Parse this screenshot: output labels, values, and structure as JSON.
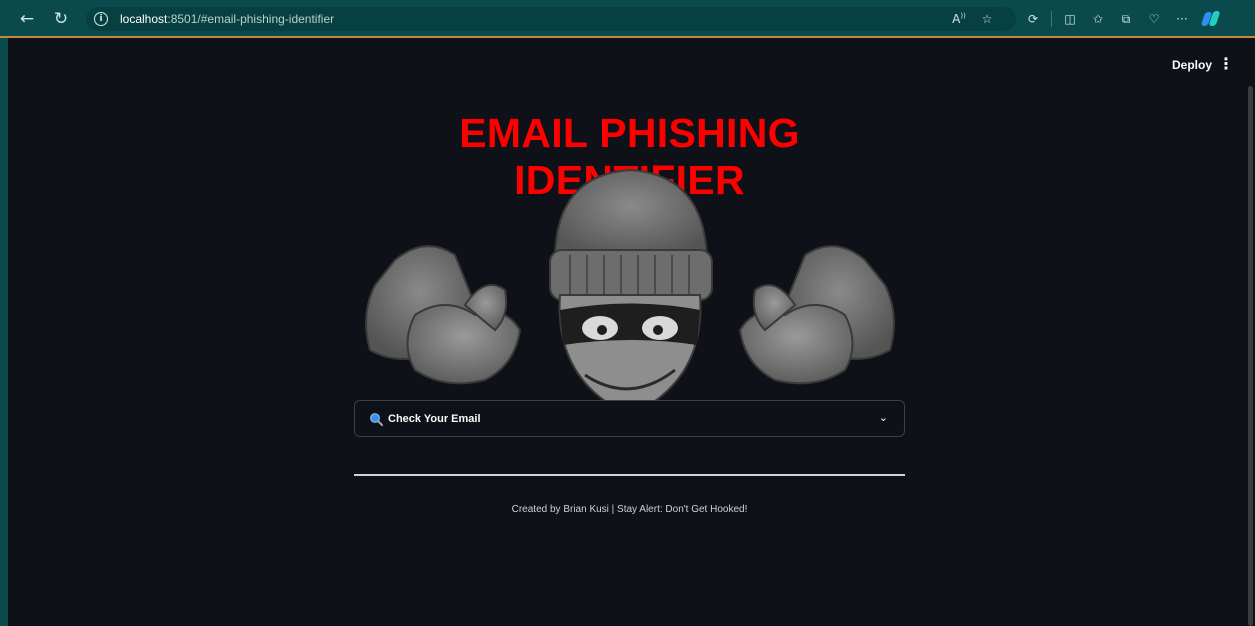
{
  "browser": {
    "url_host": "localhost",
    "url_path": ":8501/#email-phishing-identifier"
  },
  "header": {
    "deploy_label": "Deploy"
  },
  "main": {
    "title": "EMAIL PHISHING IDENTIFIER",
    "expander_label": "Check Your Email",
    "footer_text": "Created by Brian Kusi | Stay Alert: Don't Get Hooked!"
  },
  "colors": {
    "title": "#ff0000",
    "background": "#0e1117",
    "browser_bar": "#0b4a4c"
  }
}
